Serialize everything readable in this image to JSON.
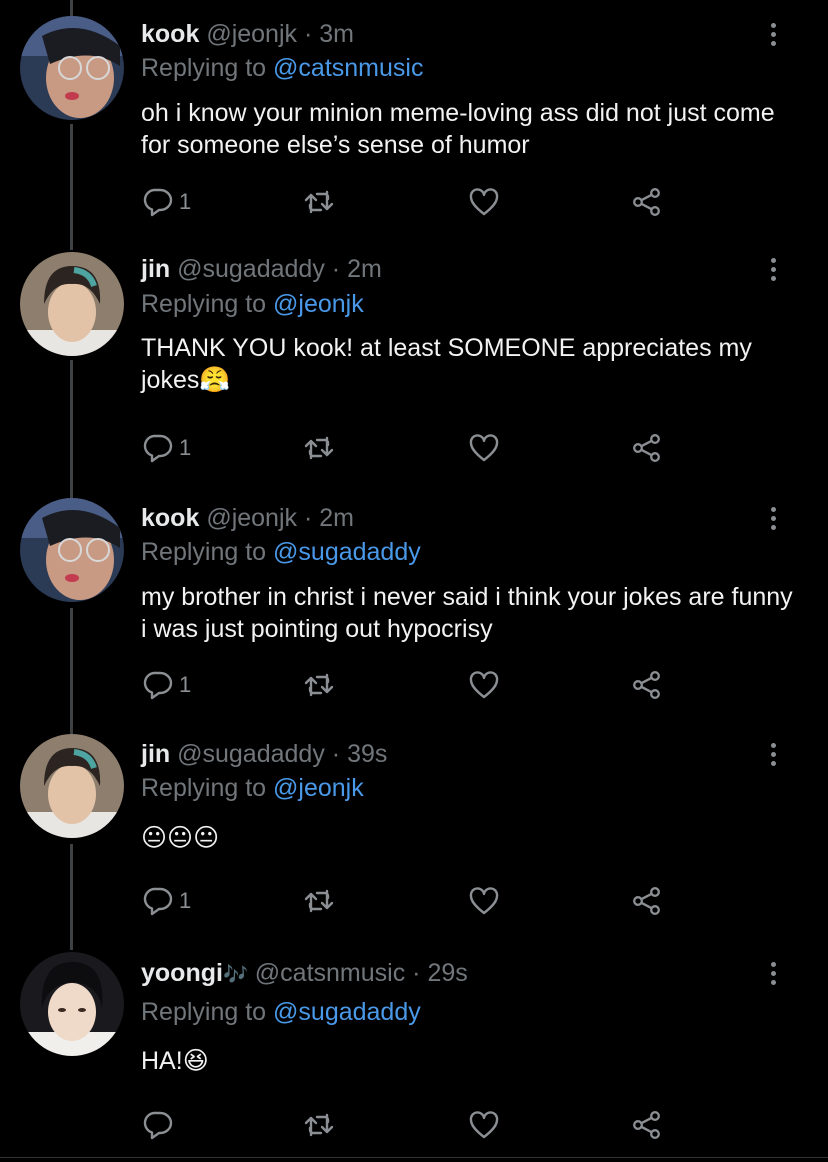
{
  "tweets": [
    {
      "name": "kook",
      "handle": "@jeonjk",
      "dot": "·",
      "time": "3m",
      "replying_label": "Replying to",
      "replying_to": "@catsnmusic",
      "text": "oh i know your minion meme-loving ass did not just come for someone else’s sense of humor",
      "reply_count": "1"
    },
    {
      "name": "jin",
      "handle": "@sugadaddy",
      "dot": "·",
      "time": "2m",
      "replying_label": "Replying to",
      "replying_to": "@jeonjk",
      "text": "THANK YOU kook! at least SOMEONE appreciates my jokes",
      "text_emoji": "😤",
      "reply_count": "1"
    },
    {
      "name": "kook",
      "handle": "@jeonjk",
      "dot": "·",
      "time": "2m",
      "replying_label": "Replying to",
      "replying_to": "@sugadaddy",
      "text": "my brother in christ i never said i think your jokes are funny i was just pointing out hypocrisy",
      "reply_count": "1"
    },
    {
      "name": "jin",
      "handle": "@sugadaddy",
      "dot": "·",
      "time": "39s",
      "replying_label": "Replying to",
      "replying_to": "@jeonjk",
      "text_emoji": "😐😐😐",
      "reply_count": "1"
    },
    {
      "name": "yoongi",
      "name_emoji": "🎶",
      "handle": "@catsnmusic",
      "dot": "·",
      "time": "29s",
      "replying_label": "Replying to",
      "replying_to": "@sugadaddy",
      "text": "HA!",
      "text_emoji": "😆",
      "reply_count": ""
    }
  ],
  "colors": {
    "background": "#000000",
    "text": "#e7e9ea",
    "muted": "#71767b",
    "link": "#4a99e9",
    "thread_line": "#3e4144"
  },
  "icons": {
    "reply": "speech-bubble-icon",
    "retweet": "retweet-icon",
    "like": "heart-icon",
    "share": "share-icon",
    "more": "vertical-dots-icon"
  }
}
